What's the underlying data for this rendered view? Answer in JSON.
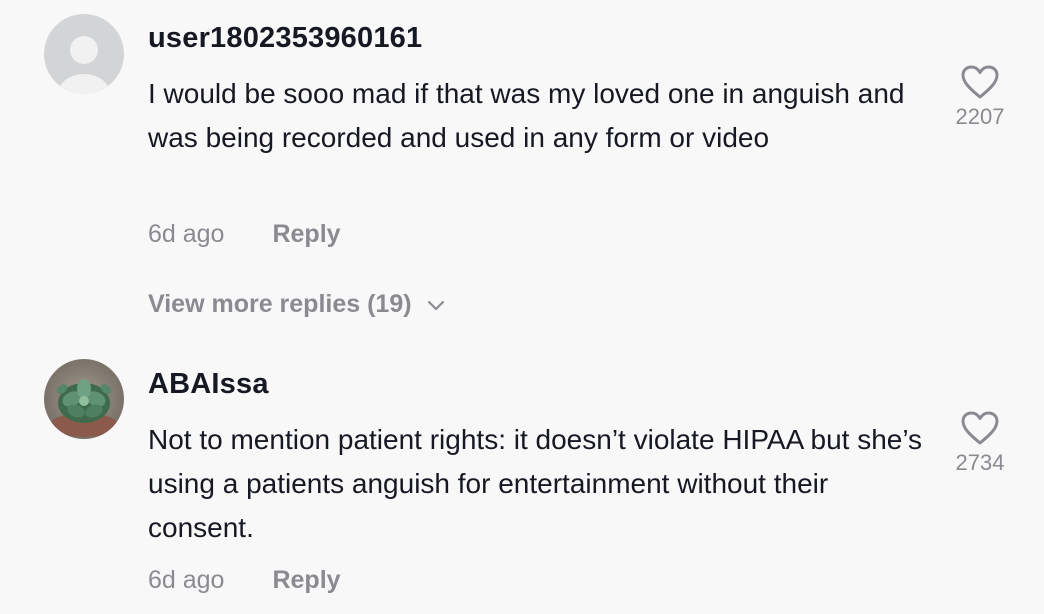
{
  "comments": [
    {
      "username": "user1802353960161",
      "text": "I would be sooo mad if that was my loved one in anguish and was being recorded and used in any form or video",
      "time": "6d ago",
      "reply_label": "Reply",
      "like_count": "2207",
      "avatar_icon": "default-user-icon"
    },
    {
      "username": "ABAIssa",
      "text": "Not to mention patient rights: it doesn’t violate HIPAA but she’s using a patients anguish for entertainment without their consent.",
      "time": "6d ago",
      "reply_label": "Reply",
      "like_count": "2734",
      "avatar_icon": "succulent-photo"
    }
  ],
  "view_more_replies": "View more replies (19)",
  "colors": {
    "background": "#f8f8f8",
    "text_primary": "#161823",
    "text_secondary": "#8a8b91"
  }
}
